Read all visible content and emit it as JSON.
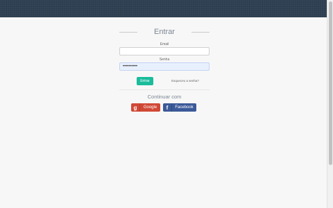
{
  "header": {
    "color": "#2c3e50"
  },
  "login": {
    "title": "Entrar",
    "email_label": "Email",
    "email_value": "",
    "password_label": "Senha",
    "password_value": "••••••••••",
    "submit_label": "Entrar",
    "forgot_label": "Esqueceu a senha?"
  },
  "social": {
    "heading": "Continuar com",
    "google_label": "Google",
    "google_icon": "g-letter-icon",
    "google_color": "#d14836",
    "facebook_label": "Facebook",
    "facebook_icon": "f-letter-icon",
    "facebook_color": "#3b5998"
  },
  "colors": {
    "accent": "#1abc9c"
  }
}
